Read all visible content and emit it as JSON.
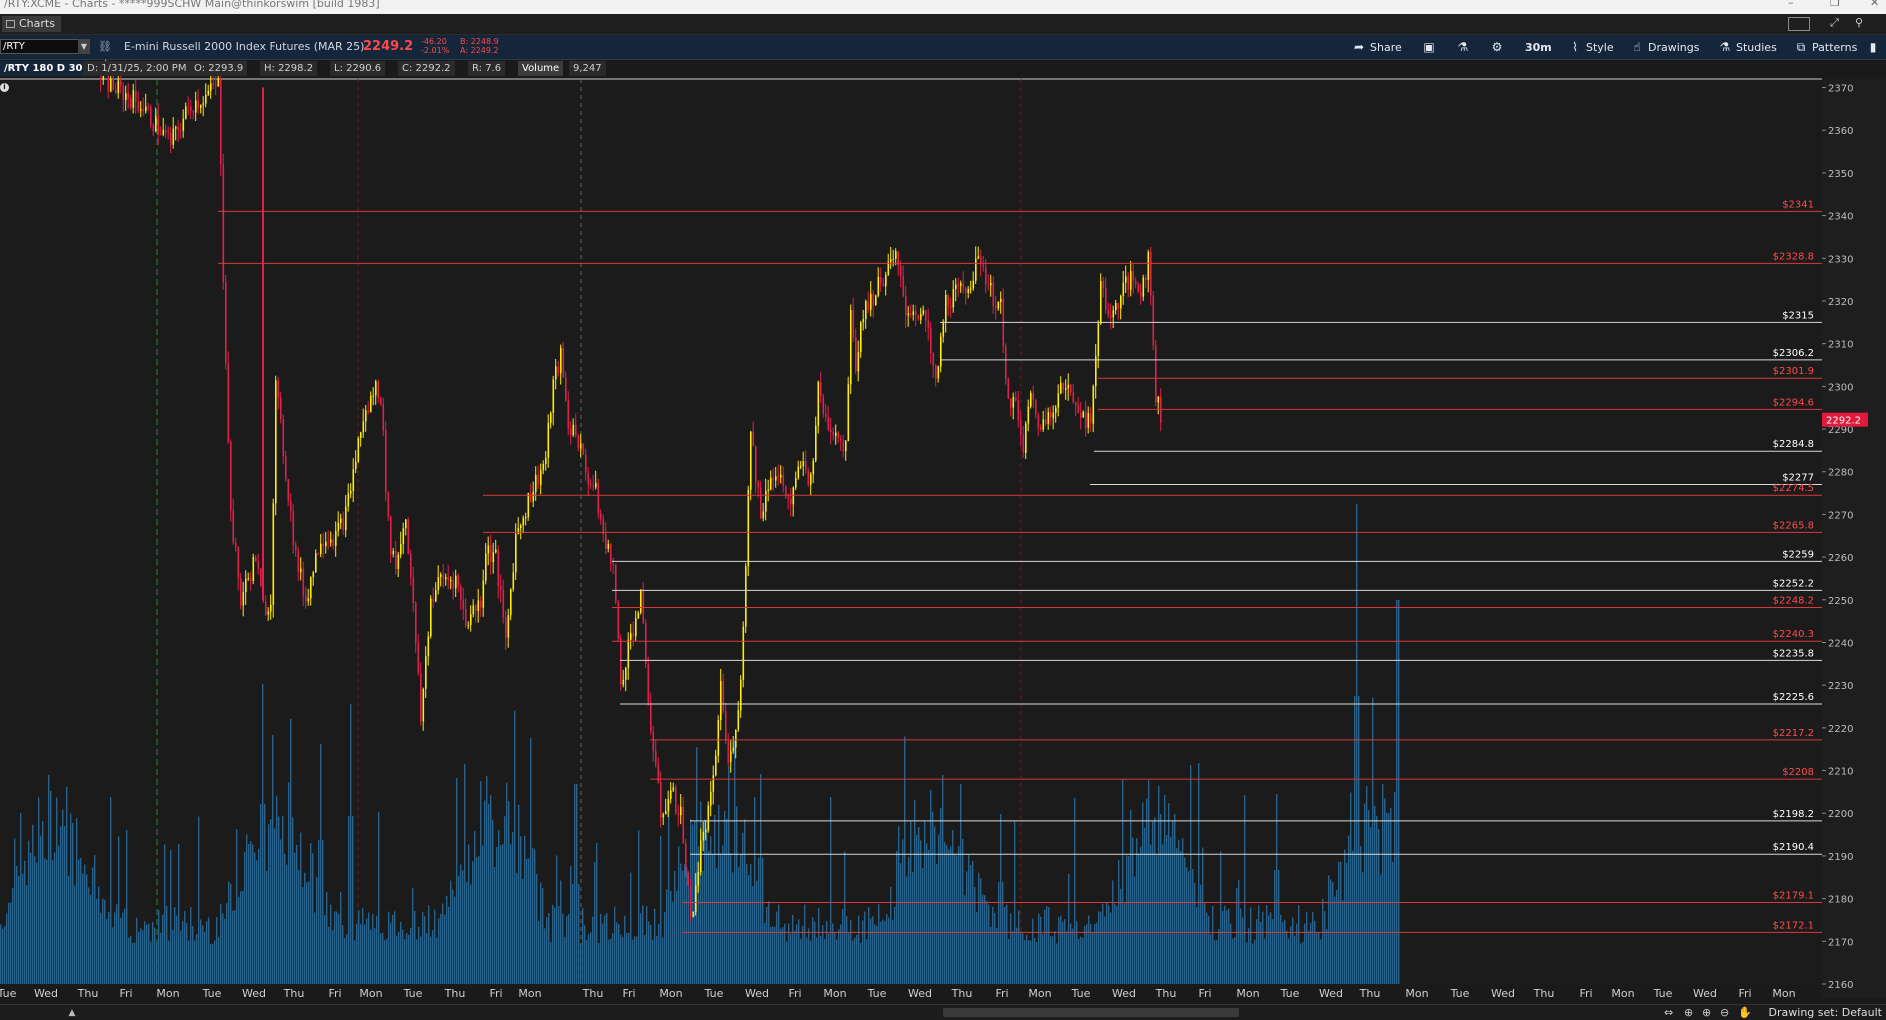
{
  "window": {
    "title": "/RTY:XCME - Charts - *****999SCHW Main@thinkorswim [build 1983]"
  },
  "tabs": [
    {
      "label": "Charts"
    }
  ],
  "toolbar": {
    "symbol": "/RTY",
    "description": "E-mini Russell 2000 Index Futures (MAR 25)",
    "last": "2249.2",
    "change": "-46.20",
    "change_pct": "-2.01%",
    "bid": "B: 2248.9",
    "ask": "A: 2249.2",
    "share": "Share",
    "timeframe": "30m",
    "style": "Style",
    "drawings": "Drawings",
    "studies": "Studies",
    "patterns": "Patterns"
  },
  "info": {
    "name": "/RTY 180 D 30m",
    "date": "D: 1/31/25, 2:00 PM",
    "open": "O: 2293.9",
    "high": "H: 2298.2",
    "low": "L: 2290.6",
    "close": "C: 2292.2",
    "range": "R: 7.6",
    "volume_label": "Volume",
    "volume": "9,247"
  },
  "colors": {
    "up": "#ffee00",
    "down": "#e0204d",
    "volume": "#2a6f9e",
    "red_line": "#d63a3a",
    "white_line": "#d8d8d8",
    "price_tag": "#e01a3a",
    "background": "#1a1a1a"
  },
  "chart_data": {
    "type": "candlestick",
    "symbol": "/RTY",
    "ylim": [
      2160,
      2372
    ],
    "y_ticks": [
      2160,
      2170,
      2180,
      2190,
      2200,
      2210,
      2220,
      2230,
      2240,
      2250,
      2260,
      2270,
      2280,
      2290,
      2300,
      2310,
      2320,
      2330,
      2340,
      2350,
      2360,
      2370
    ],
    "x_ticks": [
      "Tue",
      "Wed",
      "Thu",
      "Fri",
      "Mon",
      "Tue",
      "Wed",
      "Thu",
      "Fri",
      "Mon",
      "Tue",
      "Thu",
      "Fri",
      "Mon",
      "Thu",
      "Fri",
      "Mon",
      "Tue",
      "Wed",
      "Fri",
      "Mon",
      "Tue",
      "Wed",
      "Thu",
      "Fri",
      "Mon",
      "Tue",
      "Wed",
      "Thu",
      "Fri",
      "Mon",
      "Tue",
      "Wed",
      "Thu",
      "Mon",
      "Tue",
      "Wed",
      "Thu",
      "Fri",
      "Mon",
      "Tue",
      "Wed",
      "Fri",
      "Mon"
    ],
    "current_price": "2292.2",
    "levels": [
      {
        "price": 2341,
        "label": "$2341",
        "color": "red",
        "from_x": 218
      },
      {
        "price": 2328.8,
        "label": "$2328.8",
        "color": "red",
        "from_x": 218
      },
      {
        "price": 2315,
        "label": "$2315",
        "color": "white",
        "from_x": 940
      },
      {
        "price": 2306.2,
        "label": "$2306.2",
        "color": "white",
        "from_x": 940
      },
      {
        "price": 2301.9,
        "label": "$2301.9",
        "color": "red",
        "from_x": 1098
      },
      {
        "price": 2294.6,
        "label": "$2294.6",
        "color": "red",
        "from_x": 1098
      },
      {
        "price": 2284.8,
        "label": "$2284.8",
        "color": "white",
        "from_x": 1094
      },
      {
        "price": 2277,
        "label": "$2277",
        "color": "white",
        "from_x": 1090
      },
      {
        "price": 2274.5,
        "label": "$2274.5",
        "color": "red",
        "from_x": 483
      },
      {
        "price": 2265.8,
        "label": "$2265.8",
        "color": "red",
        "from_x": 483
      },
      {
        "price": 2259,
        "label": "$2259",
        "color": "white",
        "from_x": 612
      },
      {
        "price": 2252.2,
        "label": "$2252.2",
        "color": "white",
        "from_x": 612
      },
      {
        "price": 2248.2,
        "label": "$2248.2",
        "color": "red",
        "from_x": 612
      },
      {
        "price": 2240.3,
        "label": "$2240.3",
        "color": "red",
        "from_x": 612
      },
      {
        "price": 2235.8,
        "label": "$2235.8",
        "color": "white",
        "from_x": 620
      },
      {
        "price": 2225.6,
        "label": "$2225.6",
        "color": "white",
        "from_x": 620
      },
      {
        "price": 2217.2,
        "label": "$2217.2",
        "color": "red",
        "from_x": 650
      },
      {
        "price": 2208,
        "label": "$2208",
        "color": "red",
        "from_x": 650
      },
      {
        "price": 2198.2,
        "label": "$2198.2",
        "color": "white",
        "from_x": 690
      },
      {
        "price": 2190.4,
        "label": "$2190.4",
        "color": "white",
        "from_x": 690
      },
      {
        "price": 2179.1,
        "label": "$2179.1",
        "color": "red",
        "from_x": 682
      },
      {
        "price": 2172.1,
        "label": "$2172.1",
        "color": "red",
        "from_x": 682
      }
    ],
    "price_path": [
      [
        100,
        2372
      ],
      [
        140,
        2366
      ],
      [
        170,
        2357
      ],
      [
        190,
        2366
      ],
      [
        205,
        2368
      ],
      [
        218,
        2371
      ],
      [
        222,
        2330
      ],
      [
        230,
        2270
      ],
      [
        240,
        2250
      ],
      [
        255,
        2260
      ],
      [
        262,
        2248
      ],
      [
        270,
        2250
      ],
      [
        275,
        2300
      ],
      [
        285,
        2280
      ],
      [
        295,
        2260
      ],
      [
        305,
        2250
      ],
      [
        320,
        2265
      ],
      [
        335,
        2265
      ],
      [
        345,
        2270
      ],
      [
        360,
        2290
      ],
      [
        375,
        2300
      ],
      [
        380,
        2298
      ],
      [
        388,
        2265
      ],
      [
        395,
        2258
      ],
      [
        405,
        2270
      ],
      [
        415,
        2240
      ],
      [
        420,
        2222
      ],
      [
        430,
        2250
      ],
      [
        440,
        2255
      ],
      [
        455,
        2255
      ],
      [
        465,
        2245
      ],
      [
        480,
        2250
      ],
      [
        485,
        2262
      ],
      [
        495,
        2260
      ],
      [
        505,
        2240
      ],
      [
        515,
        2265
      ],
      [
        530,
        2275
      ],
      [
        545,
        2283
      ],
      [
        552,
        2300
      ],
      [
        560,
        2307
      ],
      [
        568,
        2290
      ],
      [
        575,
        2290
      ],
      [
        585,
        2280
      ],
      [
        595,
        2275
      ],
      [
        605,
        2262
      ],
      [
        612,
        2260
      ],
      [
        620,
        2230
      ],
      [
        628,
        2240
      ],
      [
        640,
        2250
      ],
      [
        650,
        2220
      ],
      [
        660,
        2200
      ],
      [
        670,
        2205
      ],
      [
        680,
        2200
      ],
      [
        690,
        2175
      ],
      [
        700,
        2192
      ],
      [
        712,
        2205
      ],
      [
        720,
        2230
      ],
      [
        728,
        2210
      ],
      [
        740,
        2230
      ],
      [
        750,
        2290
      ],
      [
        760,
        2270
      ],
      [
        770,
        2280
      ],
      [
        780,
        2278
      ],
      [
        790,
        2272
      ],
      [
        800,
        2282
      ],
      [
        810,
        2278
      ],
      [
        818,
        2300
      ],
      [
        825,
        2292
      ],
      [
        835,
        2290
      ],
      [
        845,
        2285
      ],
      [
        850,
        2320
      ],
      [
        855,
        2305
      ],
      [
        862,
        2318
      ],
      [
        870,
        2320
      ],
      [
        880,
        2325
      ],
      [
        895,
        2330
      ],
      [
        905,
        2318
      ],
      [
        915,
        2318
      ],
      [
        925,
        2315
      ],
      [
        935,
        2300
      ],
      [
        945,
        2320
      ],
      [
        960,
        2322
      ],
      [
        970,
        2325
      ],
      [
        980,
        2330
      ],
      [
        990,
        2322
      ],
      [
        1000,
        2318
      ],
      [
        1005,
        2300
      ],
      [
        1015,
        2295
      ],
      [
        1022,
        2285
      ],
      [
        1030,
        2298
      ],
      [
        1040,
        2290
      ],
      [
        1050,
        2295
      ],
      [
        1062,
        2300
      ],
      [
        1070,
        2298
      ],
      [
        1080,
        2295
      ],
      [
        1090,
        2290
      ],
      [
        1100,
        2325
      ],
      [
        1110,
        2315
      ],
      [
        1120,
        2322
      ],
      [
        1130,
        2325
      ],
      [
        1140,
        2323
      ],
      [
        1148,
        2330
      ],
      [
        1155,
        2298
      ],
      [
        1162,
        2292
      ]
    ],
    "volume_profile": "30m volume histogram, 0-220 scale"
  }
}
